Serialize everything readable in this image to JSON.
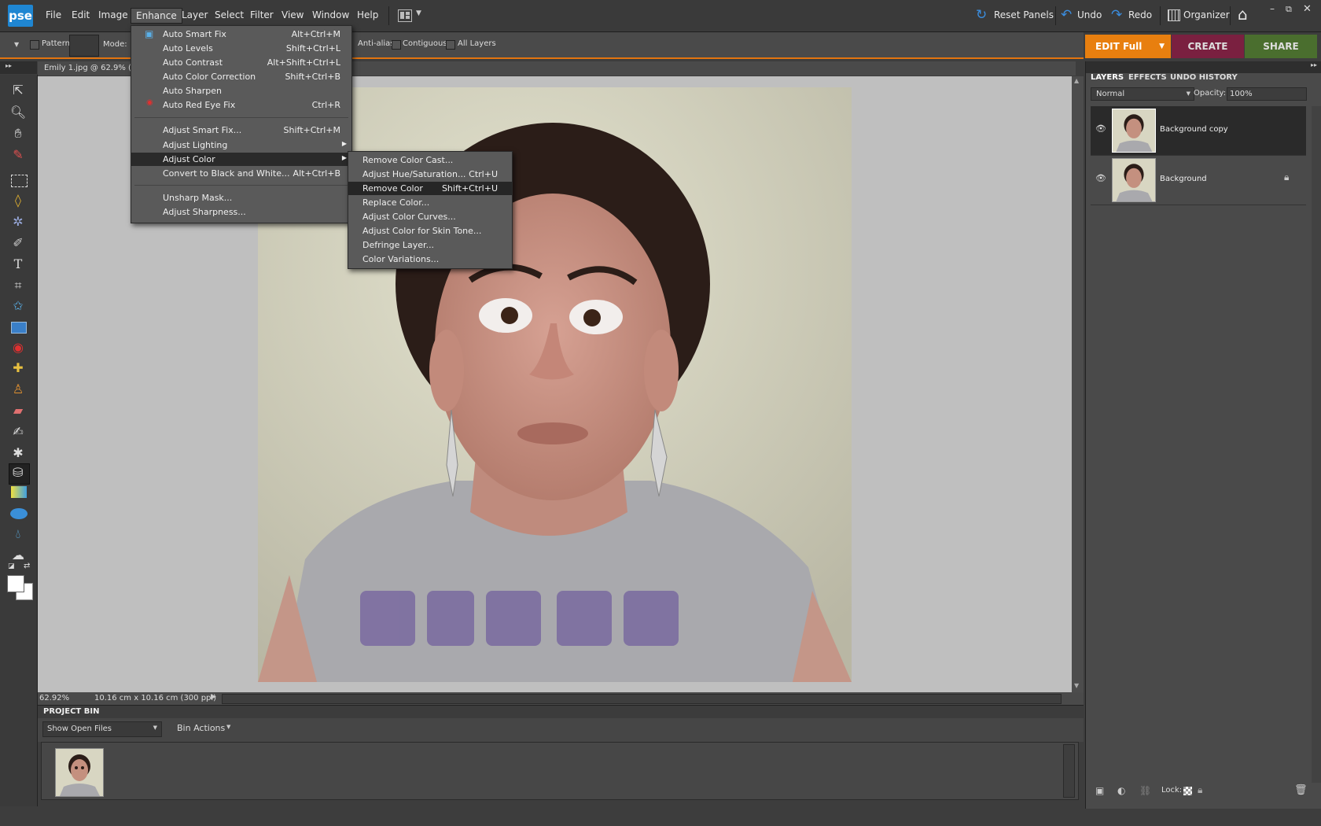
{
  "app": {
    "logo": "pse"
  },
  "menubar": {
    "items": [
      "File",
      "Edit",
      "Image",
      "Enhance",
      "Layer",
      "Select",
      "Filter",
      "View",
      "Window",
      "Help"
    ],
    "open_menu": "Enhance",
    "reset_panels": "Reset Panels",
    "undo": "Undo",
    "redo": "Redo",
    "organizer": "Organizer"
  },
  "options_bar": {
    "pattern": "Pattern",
    "mode": "Mode:",
    "anti_alias": "Anti-alias",
    "contiguous": "Contiguous",
    "all_layers": "All Layers"
  },
  "mode_buttons": {
    "edit": "EDIT Full",
    "create": "CREATE",
    "share": "SHARE"
  },
  "document": {
    "tab_title": "Emily 1.jpg @ 62.9% (Bac",
    "zoom": "62.92%",
    "doc_size": "10.16 cm x 10.16 cm (300 ppi)"
  },
  "enhance_menu": {
    "items": [
      {
        "label": "Auto Smart Fix",
        "shortcut": "Alt+Ctrl+M"
      },
      {
        "label": "Auto Levels",
        "shortcut": "Shift+Ctrl+L"
      },
      {
        "label": "Auto Contrast",
        "shortcut": "Alt+Shift+Ctrl+L"
      },
      {
        "label": "Auto Color Correction",
        "shortcut": "Shift+Ctrl+B"
      },
      {
        "label": "Auto Sharpen",
        "shortcut": ""
      },
      {
        "label": "Auto Red Eye Fix",
        "shortcut": "Ctrl+R"
      },
      {
        "label": "Adjust Smart Fix...",
        "shortcut": "Shift+Ctrl+M"
      },
      {
        "label": "Adjust Lighting",
        "shortcut": ""
      },
      {
        "label": "Adjust Color",
        "shortcut": ""
      },
      {
        "label": "Convert to Black and White...",
        "shortcut": "Alt+Ctrl+B"
      },
      {
        "label": "Unsharp Mask...",
        "shortcut": ""
      },
      {
        "label": "Adjust Sharpness...",
        "shortcut": ""
      }
    ]
  },
  "adjust_color_menu": {
    "items": [
      {
        "label": "Remove Color Cast...",
        "shortcut": ""
      },
      {
        "label": "Adjust Hue/Saturation...",
        "shortcut": "Ctrl+U"
      },
      {
        "label": "Remove Color",
        "shortcut": "Shift+Ctrl+U"
      },
      {
        "label": "Replace Color...",
        "shortcut": ""
      },
      {
        "label": "Adjust Color Curves...",
        "shortcut": ""
      },
      {
        "label": "Adjust Color for Skin Tone...",
        "shortcut": ""
      },
      {
        "label": "Defringe Layer...",
        "shortcut": ""
      },
      {
        "label": "Color Variations...",
        "shortcut": ""
      }
    ]
  },
  "panel": {
    "tabs": [
      "LAYERS",
      "EFFECTS",
      "UNDO HISTORY"
    ],
    "blend_mode": "Normal",
    "opacity_label": "Opacity:",
    "opacity_value": "100%",
    "layers": [
      {
        "name": "Background copy"
      },
      {
        "name": "Background"
      }
    ],
    "lock_label": "Lock:"
  },
  "project_bin": {
    "header": "PROJECT BIN",
    "show_dropdown": "Show Open Files",
    "bin_actions": "Bin Actions"
  }
}
